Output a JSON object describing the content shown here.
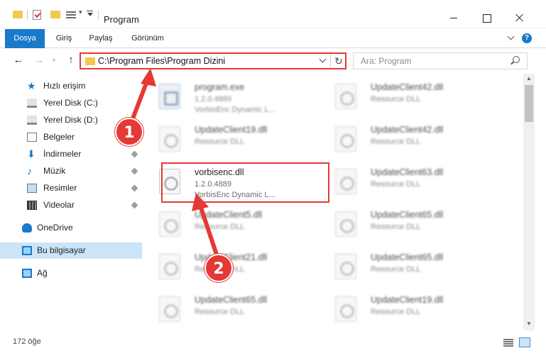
{
  "titlebar": {
    "title": "Program"
  },
  "ribbon": {
    "tabs": [
      "Dosya",
      "Giriş",
      "Paylaş",
      "Görünüm"
    ],
    "help_glyph": "?"
  },
  "address": {
    "path": "C:\\Program Files\\Program Dizini",
    "refresh_glyph": "↻"
  },
  "search": {
    "placeholder": "Ara: Program"
  },
  "nav": {
    "back": "←",
    "forward": "→",
    "recent": "▾",
    "up": "↑"
  },
  "sidebar": {
    "items": [
      {
        "label": "Hızlı erişim",
        "icon": "star-icon"
      },
      {
        "label": "Yerel Disk (C:)",
        "icon": "drive-icon"
      },
      {
        "label": "Yerel Disk (D:)",
        "icon": "drive-icon"
      },
      {
        "label": "Belgeler",
        "icon": "document-icon"
      },
      {
        "label": "İndirmeler",
        "icon": "download-icon"
      },
      {
        "label": "Müzik",
        "icon": "music-icon"
      },
      {
        "label": "Resimler",
        "icon": "pictures-icon"
      },
      {
        "label": "Videolar",
        "icon": "video-icon"
      },
      {
        "label": "OneDrive",
        "icon": "cloud-icon"
      },
      {
        "label": "Bu bilgisayar",
        "icon": "computer-icon",
        "selected": true
      },
      {
        "label": "Ağ",
        "icon": "network-icon"
      }
    ]
  },
  "files": {
    "left": [
      {
        "name": "program.exe",
        "meta1": "1.2.0.4889",
        "meta2": "VorbisEnc Dynamic L..."
      },
      {
        "name": "UpdateClient19.dll",
        "meta1": "Resource DLL",
        "meta2": ""
      },
      {
        "name": "vorbisenc.dll",
        "meta1": "1.2.0.4889",
        "meta2": "VorbisEnc Dynamic L..."
      },
      {
        "name": "UpdateClient5.dll",
        "meta1": "Resource DLL",
        "meta2": ""
      },
      {
        "name": "UpdateClient21.dll",
        "meta1": "Resource DLL",
        "meta2": ""
      },
      {
        "name": "UpdateClient65.dll",
        "meta1": "Resource DLL",
        "meta2": ""
      }
    ],
    "right": [
      {
        "name": "UpdateClient42.dll",
        "meta1": "Resource DLL"
      },
      {
        "name": "UpdateClient42.dll",
        "meta1": "Resource DLL"
      },
      {
        "name": "UpdateClient63.dll",
        "meta1": "Resource DLL"
      },
      {
        "name": "UpdateClient65.dll",
        "meta1": "Resource DLL"
      },
      {
        "name": "UpdateClient65.dll",
        "meta1": "Resource DLL"
      },
      {
        "name": "UpdateClient19.dll",
        "meta1": "Resource DLL"
      }
    ]
  },
  "status": {
    "count": "172 öğe"
  },
  "annotations": {
    "badge1": "1",
    "badge2": "2",
    "color": "#e53935"
  },
  "colors": {
    "accent": "#1979ca",
    "selection": "#cce4f7"
  }
}
